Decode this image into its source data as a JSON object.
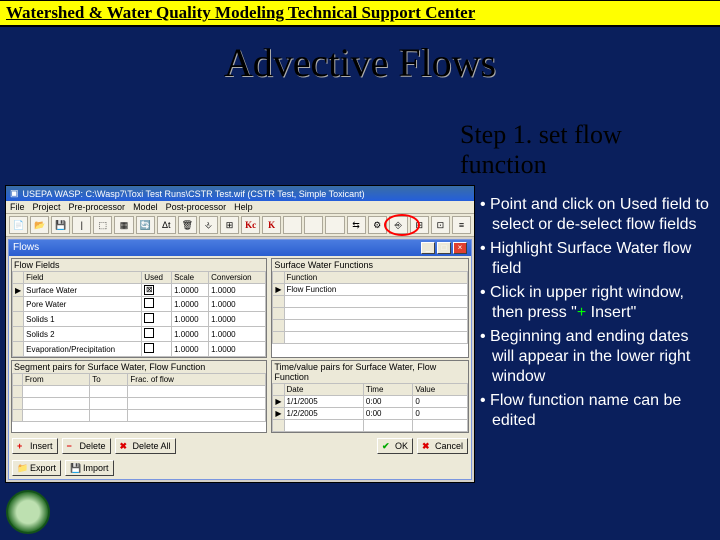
{
  "banner": "Watershed & Water Quality Modeling Technical Support Center",
  "title": "Advective Flows",
  "step_title": "Step 1. set flow function",
  "bullets": [
    {
      "pre": "Point and click on Used field to select or de-select flow fields"
    },
    {
      "pre": "Highlight Surface Water flow field"
    },
    {
      "pre": "Click in upper right window, then press \"",
      "hl": "+",
      "post": " Insert\""
    },
    {
      "pre": "Beginning and ending dates will appear in the lower right window"
    },
    {
      "pre": "Flow function name can be edited"
    }
  ],
  "app": {
    "window_title": "USEPA WASP: C:\\Wasp7\\Toxi Test Runs\\CSTR Test.wif (CSTR Test, Simple Toxicant)",
    "menu": [
      "File",
      "Project",
      "Pre-processor",
      "Model",
      "Post-processor",
      "Help"
    ],
    "toolbar_count": 22,
    "flows_title": "Flows",
    "left_label": "Flow Fields",
    "right_label": "Surface Water Functions",
    "left_headers": [
      "",
      "Field",
      "Used",
      "Scale",
      "Conversion"
    ],
    "left_rows": [
      {
        "sel": "▶",
        "field": "Surface Water",
        "used": true,
        "scale": "1.0000",
        "conv": "1.0000"
      },
      {
        "sel": "",
        "field": "Pore Water",
        "used": false,
        "scale": "1.0000",
        "conv": "1.0000"
      },
      {
        "sel": "",
        "field": "Solids 1",
        "used": false,
        "scale": "1.0000",
        "conv": "1.0000"
      },
      {
        "sel": "",
        "field": "Solids 2",
        "used": false,
        "scale": "1.0000",
        "conv": "1.0000"
      },
      {
        "sel": "",
        "field": "Evaporation/Precipitation",
        "used": false,
        "scale": "1.0000",
        "conv": "1.0000"
      }
    ],
    "right_headers": [
      "",
      "Function"
    ],
    "right_rows": [
      {
        "sel": "▶",
        "fn": "Flow Function"
      }
    ],
    "seg_label": "Segment pairs for Surface Water, Flow Function",
    "tv_label": "Time/value pairs for Surface Water, Flow Function",
    "seg_headers": [
      "",
      "From",
      "To",
      "Frac. of flow"
    ],
    "tv_headers": [
      "",
      "Date",
      "Time",
      "Value"
    ],
    "tv_rows": [
      {
        "date": "1/1/2005",
        "time": "0:00",
        "val": "0"
      },
      {
        "date": "1/2/2005",
        "time": "0:00",
        "val": "0"
      }
    ],
    "buttons_left": [
      {
        "icon": "plus",
        "glyph": "+",
        "label": "Insert"
      },
      {
        "icon": "minus",
        "glyph": "−",
        "label": "Delete"
      },
      {
        "icon": "x",
        "glyph": "✖",
        "label": "Delete All"
      }
    ],
    "buttons_left2": [
      {
        "icon": "folder",
        "glyph": "",
        "label": "Export"
      },
      {
        "icon": "disk",
        "glyph": "",
        "label": "Import"
      }
    ],
    "buttons_right": [
      {
        "icon": "check",
        "glyph": "✔",
        "label": "OK"
      },
      {
        "icon": "x",
        "glyph": "✖",
        "label": "Cancel"
      }
    ]
  }
}
